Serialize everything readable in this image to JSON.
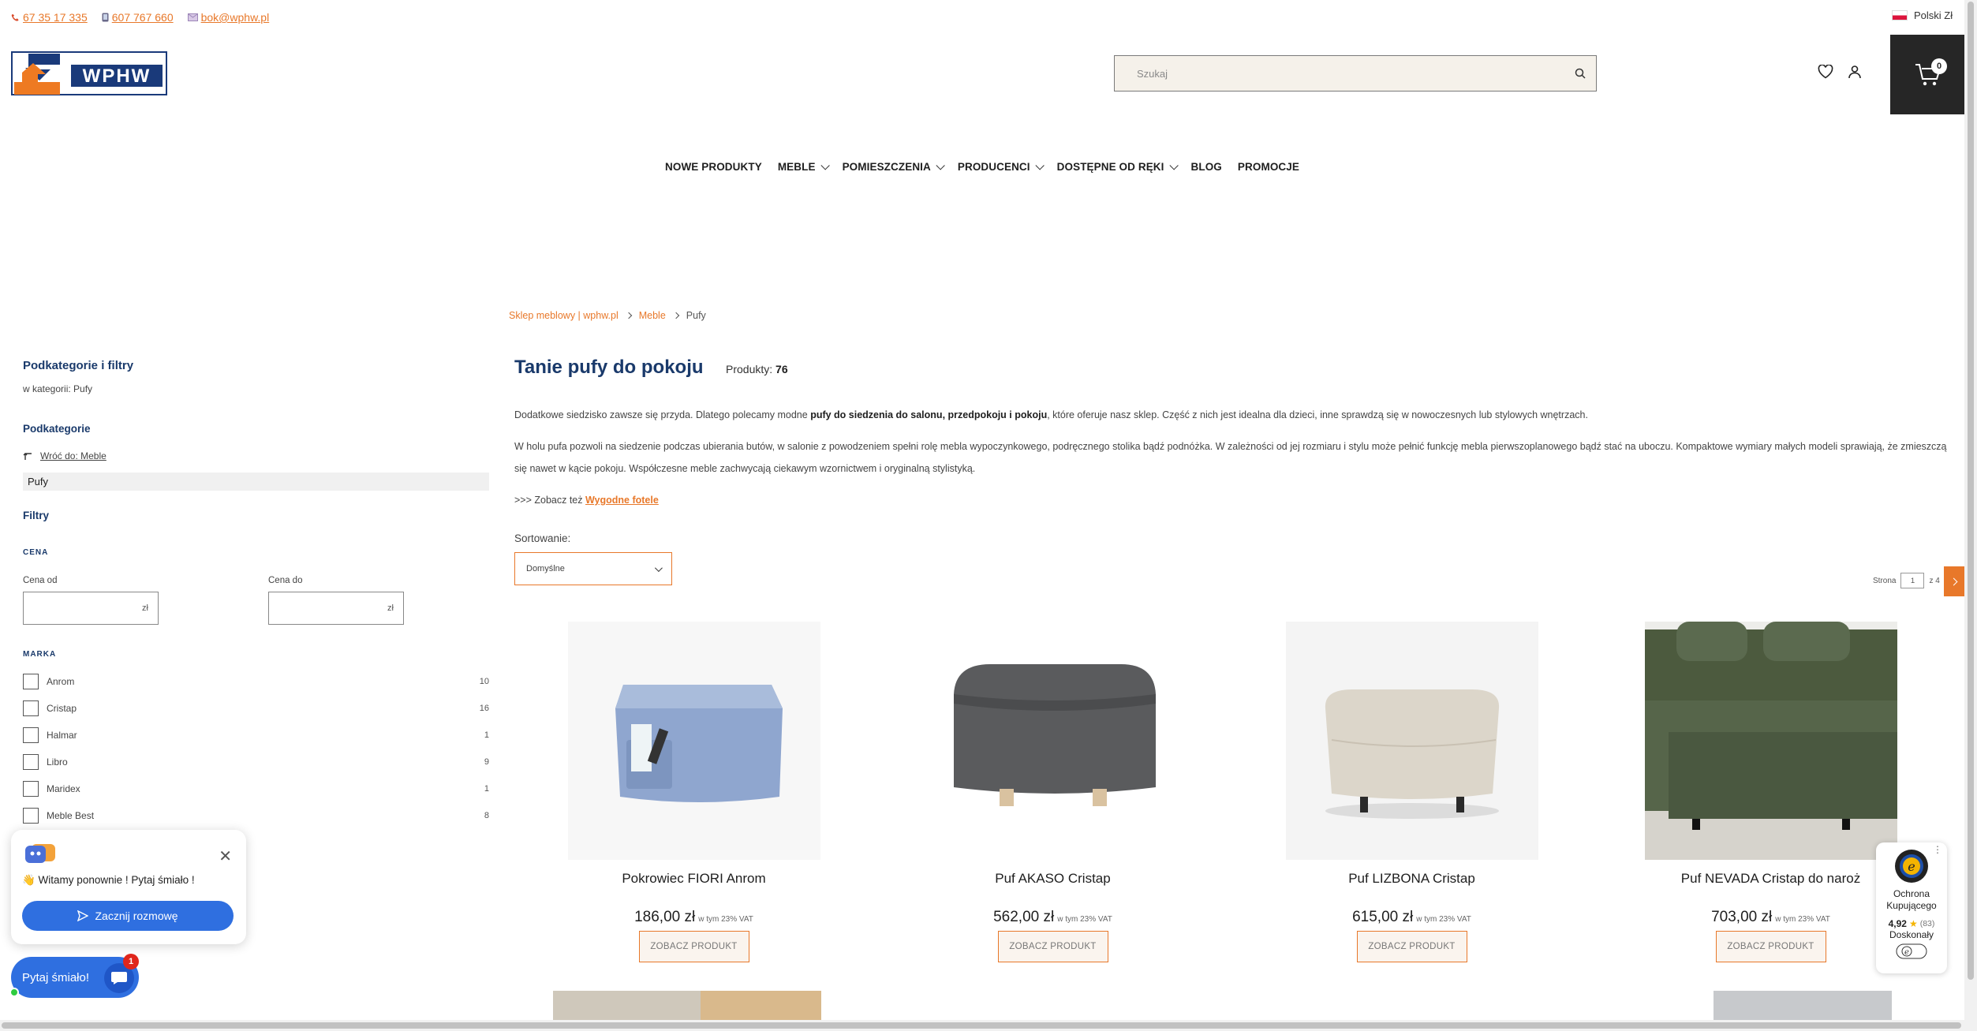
{
  "topbar": {
    "phone": "67 35 17 335",
    "mobile": "607 767 660",
    "email": "bok@wphw.pl",
    "currency": "Polski Zł"
  },
  "logo": {
    "text": "WPHW"
  },
  "search": {
    "placeholder": "Szukaj"
  },
  "cart": {
    "count": "0"
  },
  "nav": [
    {
      "label": "NOWE PRODUKTY",
      "dropdown": false
    },
    {
      "label": "MEBLE",
      "dropdown": true
    },
    {
      "label": "POMIESZCZENIA",
      "dropdown": true
    },
    {
      "label": "PRODUCENCI",
      "dropdown": true
    },
    {
      "label": "DOSTĘPNE OD RĘKI",
      "dropdown": true
    },
    {
      "label": "BLOG",
      "dropdown": false
    },
    {
      "label": "PROMOCJE",
      "dropdown": false
    }
  ],
  "breadcrumb": [
    "Sklep meblowy | wphw.pl",
    "Meble",
    "Pufy"
  ],
  "sidebar": {
    "title": "Podkategorie i filtry",
    "in_category": "w kategorii: Pufy",
    "subcat_title": "Podkategorie",
    "back_link": "Wróć do: Meble",
    "active": "Pufy",
    "filters_title": "Filtry",
    "price_label": "CENA",
    "price_from": "Cena od",
    "price_to": "Cena do",
    "currency": "zł",
    "brand_label": "MARKA",
    "brands": [
      {
        "name": "Anrom",
        "count": "10"
      },
      {
        "name": "Cristap",
        "count": "16"
      },
      {
        "name": "Halmar",
        "count": "1"
      },
      {
        "name": "Libro",
        "count": "9"
      },
      {
        "name": "Maridex",
        "count": "1"
      },
      {
        "name": "Meble Best",
        "count": "8"
      }
    ]
  },
  "main": {
    "title": "Tanie pufy do pokoju",
    "count_label": "Produkty:",
    "count": "76",
    "desc1_a": "Dodatkowe siedzisko zawsze się przyda. Dlatego polecamy modne ",
    "desc1_b": "pufy do siedzenia do salonu, przedpokoju i pokoju",
    "desc1_c": ", które oferuje nasz sklep. Część z nich jest idealna dla dzieci, inne sprawdzą się w nowoczesnych lub stylowych wnętrzach.",
    "desc2": "W holu pufa pozwoli na siedzenie podczas ubierania butów, w salonie z powodzeniem spełni rolę mebla wypoczynkowego, podręcznego stolika bądź podnóżka. W zależności od jej rozmiaru i stylu może pełnić funkcję mebla pierwszoplanowego bądź stać na uboczu. Kompaktowe wymiary małych modeli sprawiają, że zmieszczą się nawet w kącie pokoju. Współczesne meble zachwycają ciekawym wzornictwem i oryginalną stylistyką.",
    "see_also": ">>> Zobacz też ",
    "see_also_link": "Wygodne fotele",
    "sort_label": "Sortowanie:",
    "sort_value": "Domyślne",
    "page_label": "Strona",
    "page_current": "1",
    "page_total": "z 4"
  },
  "products": [
    {
      "name": "Pokrowiec FIORI Anrom",
      "price": "186,00 zł",
      "vat": "w tym 23% VAT",
      "button": "ZOBACZ PRODUKT",
      "color": "#8fa6cf"
    },
    {
      "name": "Puf AKASO Cristap",
      "price": "562,00 zł",
      "vat": "w tym 23% VAT",
      "button": "ZOBACZ PRODUKT",
      "color": "#5a5b5d"
    },
    {
      "name": "Puf LIZBONA Cristap",
      "price": "615,00 zł",
      "vat": "w tym 23% VAT",
      "button": "ZOBACZ PRODUKT",
      "color": "#dcd6ca"
    },
    {
      "name": "Puf NEVADA Cristap do naroż",
      "price": "703,00 zł",
      "vat": "w tym 23% VAT",
      "button": "ZOBACZ PRODUKT",
      "color": "#4c5a3e"
    }
  ],
  "chat": {
    "greeting": "👋 Witamy ponownie ! Pytaj śmiało !",
    "start": "Zacznij rozmowę",
    "pill": "Pytaj śmiało!",
    "unread": "1"
  },
  "trust": {
    "line1": "Ochrona",
    "line2": "Kupującego",
    "score": "4,92",
    "reviews": "(83)",
    "level": "Doskonały"
  }
}
